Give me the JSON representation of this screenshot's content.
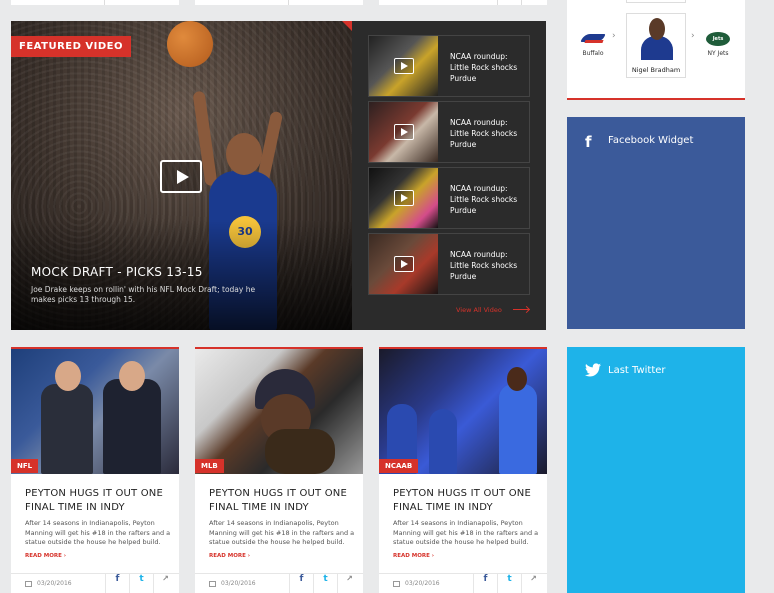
{
  "featured": {
    "badge": "FEATURED VIDEO",
    "title": "MOCK DRAFT - PICKS 13-15",
    "description": "Joe Drake keeps on rollin' with his NFL Mock Draft; today he makes picks 13 through 15.",
    "jersey_number": "30",
    "videos": [
      {
        "title": "NCAA roundup: Little Rock shocks Purdue"
      },
      {
        "title": "NCAA roundup: Little Rock shocks Purdue"
      },
      {
        "title": "NCAA roundup: Little Rock shocks Purdue"
      },
      {
        "title": "NCAA roundup: Little Rock shocks Purdue"
      }
    ],
    "view_all": "View All Video"
  },
  "sidebar": {
    "team_left": "Buffalo",
    "team_right": "NY Jets",
    "team_right_logo_text": "Jets",
    "player_name": "Nigel Bradham",
    "facebook_title": "Facebook Widget",
    "twitter_title": "Last Twitter",
    "colors": {
      "accent": "#d6322a",
      "facebook": "#3b5a9a",
      "twitter": "#1eb3e9"
    }
  },
  "cards": [
    {
      "category": "NFL",
      "title": "PEYTON HUGS IT OUT ONE FINAL TIME IN INDY",
      "description": "After 14 seasons in Indianapolis, Peyton Manning will get his #18 in the rafters and a statue outside the house he helped build.",
      "read_more": "READ MORE",
      "date": "03/20/2016"
    },
    {
      "category": "MLB",
      "title": "PEYTON HUGS IT OUT ONE FINAL TIME IN INDY",
      "description": "After 14 seasons in Indianapolis, Peyton Manning will get his #18 in the rafters and a statue outside the house he helped build.",
      "read_more": "READ MORE",
      "date": "03/20/2016"
    },
    {
      "category": "NCAAB",
      "title": "PEYTON HUGS IT OUT ONE FINAL TIME IN INDY",
      "description": "After 14 seasons in Indianapolis, Peyton Manning will get his #18 in the rafters and a statue outside the house he helped build.",
      "read_more": "READ MORE",
      "date": "03/20/2016"
    }
  ],
  "share": {
    "facebook": "f",
    "twitter": "t",
    "share": "↗"
  }
}
